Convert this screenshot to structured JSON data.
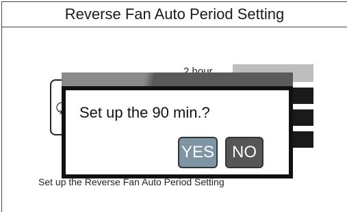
{
  "title": "Reverse Fan Auto Period Setting",
  "background": {
    "option_label": "2 hour",
    "footer_text": "Set up the Reverse Fan Auto Period Setting",
    "icon": "reverse-arrow-icon"
  },
  "dialog": {
    "message": "Set up the 90 min.?",
    "yes_label": "YES",
    "no_label": "NO"
  },
  "colors": {
    "yes_button": "#7e95a3",
    "no_button": "#565656",
    "selected_option": "#bdbdbd"
  }
}
